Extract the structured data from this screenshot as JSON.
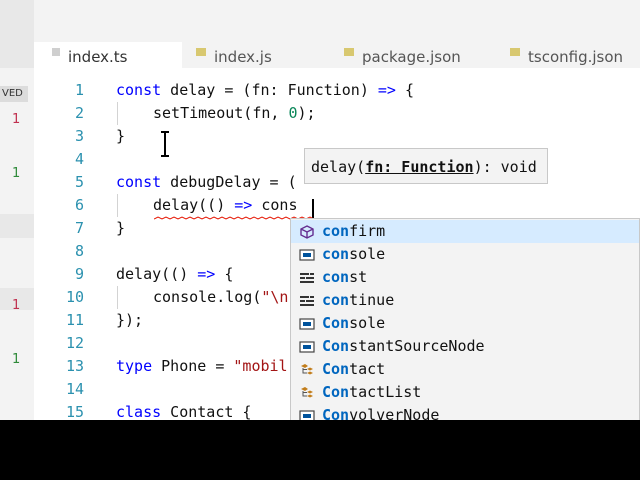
{
  "tabs": [
    {
      "label": "index.ts",
      "active": true
    },
    {
      "label": "index.js",
      "active": false
    },
    {
      "label": "package.json",
      "active": false
    },
    {
      "label": "tsconfig.json",
      "active": false
    }
  ],
  "left_panel": {
    "saved_badge": "VED",
    "counts": [
      "1",
      "1",
      "1",
      "1"
    ]
  },
  "line_numbers": [
    "1",
    "2",
    "3",
    "4",
    "5",
    "6",
    "7",
    "8",
    "9",
    "10",
    "11",
    "12",
    "13",
    "14",
    "15"
  ],
  "code": {
    "l1": {
      "kw": "const",
      "a": " delay = (fn: Function) ",
      "kw2": "=>",
      "b": " {"
    },
    "l2": {
      "a": "setTimeout(fn, ",
      "num": "0",
      "b": ");"
    },
    "l3": {
      "a": "}"
    },
    "l5": {
      "kw": "const",
      "a": " debugDelay = ("
    },
    "l6": {
      "a": "delay(() ",
      "kw": "=>",
      "b": " cons"
    },
    "l7": {
      "a": "}"
    },
    "l9": {
      "a": "delay(() ",
      "kw": "=>",
      "b": " {"
    },
    "l10": {
      "a": "console.log(",
      "str": "\"\\n"
    },
    "l11": {
      "a": "});"
    },
    "l13": {
      "kw": "type",
      "a": " Phone = ",
      "str": "\"mobil"
    },
    "l15": {
      "kw": "class",
      "a": " Contact {"
    }
  },
  "param_hint": {
    "pre": "delay(",
    "param": "fn: Function",
    "post": "): void"
  },
  "suggestions": [
    {
      "match": "con",
      "rest": "firm",
      "icon": "method-icon",
      "selected": true
    },
    {
      "match": "con",
      "rest": "sole",
      "icon": "variable-icon",
      "selected": false
    },
    {
      "match": "con",
      "rest": "st",
      "icon": "keyword-icon",
      "selected": false
    },
    {
      "match": "con",
      "rest": "tinue",
      "icon": "keyword-icon",
      "selected": false
    },
    {
      "match": "Con",
      "rest": "sole",
      "icon": "variable-icon",
      "selected": false
    },
    {
      "match": "Con",
      "rest": "stantSourceNode",
      "icon": "variable-icon",
      "selected": false
    },
    {
      "match": "Con",
      "rest": "tact",
      "icon": "class-icon",
      "selected": false
    },
    {
      "match": "Con",
      "rest": "tactList",
      "icon": "class-icon",
      "selected": false
    },
    {
      "match": "Con",
      "rest": "volverNode",
      "icon": "variable-icon",
      "selected": false
    }
  ],
  "colors": {
    "keyword": "#0000ff",
    "number": "#098658",
    "string": "#a31515",
    "linenumber": "#2b91af",
    "match": "#0066bf"
  }
}
